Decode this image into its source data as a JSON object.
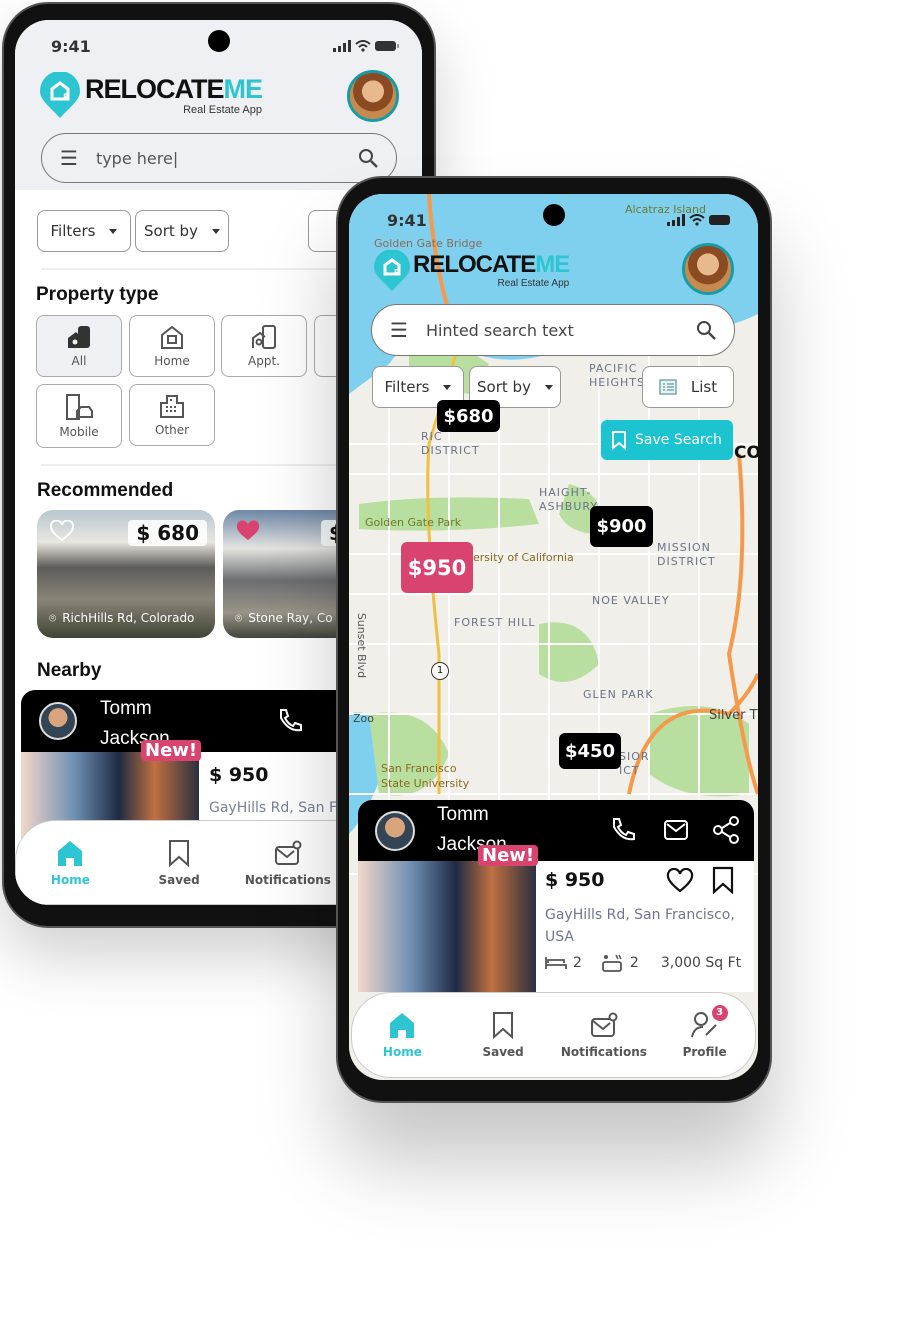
{
  "brand": {
    "name_a": "RELOCATE",
    "name_b": "ME",
    "tagline": "Real Estate App"
  },
  "colors": {
    "accent": "#2ec5d3",
    "pink": "#d9436f",
    "marker": "#000000",
    "water": "#7fd0ef",
    "park": "#b9dfa0"
  },
  "status": {
    "time": "9:41"
  },
  "phone1": {
    "search": {
      "value": "type here|"
    },
    "filters_label": "Filters",
    "sort_label": "Sort by",
    "property_type_title": "Property type",
    "property_types": [
      {
        "label": "All",
        "icon": "buildings-icon",
        "selected": true
      },
      {
        "label": "Home",
        "icon": "home-icon"
      },
      {
        "label": "Appt.",
        "icon": "apartment-icon"
      },
      {
        "label": "Mobile",
        "icon": "mobile-home-icon"
      },
      {
        "label": "Other",
        "icon": "office-icon"
      }
    ],
    "recommended_title": "Recommended",
    "recommended": [
      {
        "price": "$ 680",
        "location": "RichHills Rd, Colorado",
        "favorite": false
      },
      {
        "price": "$",
        "location": "Stone Ray, Co",
        "favorite": true
      }
    ],
    "nearby_title": "Nearby",
    "nearby": {
      "agent_first": "Tomm",
      "agent_last": "Jackson",
      "badge": "New!",
      "price": "$ 950",
      "address": "GayHills Rd, San Fr"
    },
    "nav": [
      {
        "label": "Home",
        "active": true
      },
      {
        "label": "Saved"
      },
      {
        "label": "Notifications"
      }
    ]
  },
  "phone2": {
    "search": {
      "placeholder": "Hinted search text"
    },
    "filters_label": "Filters",
    "sort_label": "Sort by",
    "list_label": "List",
    "save_search_label": "Save Search",
    "markers": [
      {
        "price": "$680",
        "highlight": false
      },
      {
        "price": "$950",
        "highlight": true
      },
      {
        "price": "$900",
        "highlight": false
      },
      {
        "price": "$450",
        "highlight": false
      }
    ],
    "map_labels": {
      "alcatraz": "Alcatraz Island",
      "golden_gate_bridge": "Golden Gate Bridge",
      "pacific_heights_1": "PACIFIC",
      "pacific_heights_2": "HEIGHTS",
      "richmond_1": "RIC",
      "richmond_2": "DISTRICT",
      "haight_1": "HAIGHT-",
      "haight_2": "ASHBURY",
      "golden_gate_park": "Golden Gate Park",
      "ucsf": "ersity of California",
      "mission_1": "MISSION",
      "mission_2": "DISTRICT",
      "noe_valley": "NOE VALLEY",
      "forest_hill": "FOREST HILL",
      "sunset_blvd": "Sunset Blvd",
      "glen_park": "GLEN PARK",
      "zoo": "Zoo",
      "silver": "Silver T",
      "sfsu_1": "San Francisco",
      "sfsu_2": "State University",
      "excelsior_1": "SIOR",
      "excelsior_2": "ICT",
      "sf_partial": "CO",
      "route_1": "1"
    },
    "card": {
      "agent_first": "Tomm",
      "agent_last": "Jackson",
      "badge": "New!",
      "price": "$ 950",
      "address": "GayHills Rd, San Francisco, USA",
      "beds": "2",
      "baths": "2",
      "area": "3,000 Sq Ft"
    },
    "nav": [
      {
        "label": "Home",
        "active": true
      },
      {
        "label": "Saved"
      },
      {
        "label": "Notifications"
      },
      {
        "label": "Profile",
        "badge": "3"
      }
    ]
  }
}
